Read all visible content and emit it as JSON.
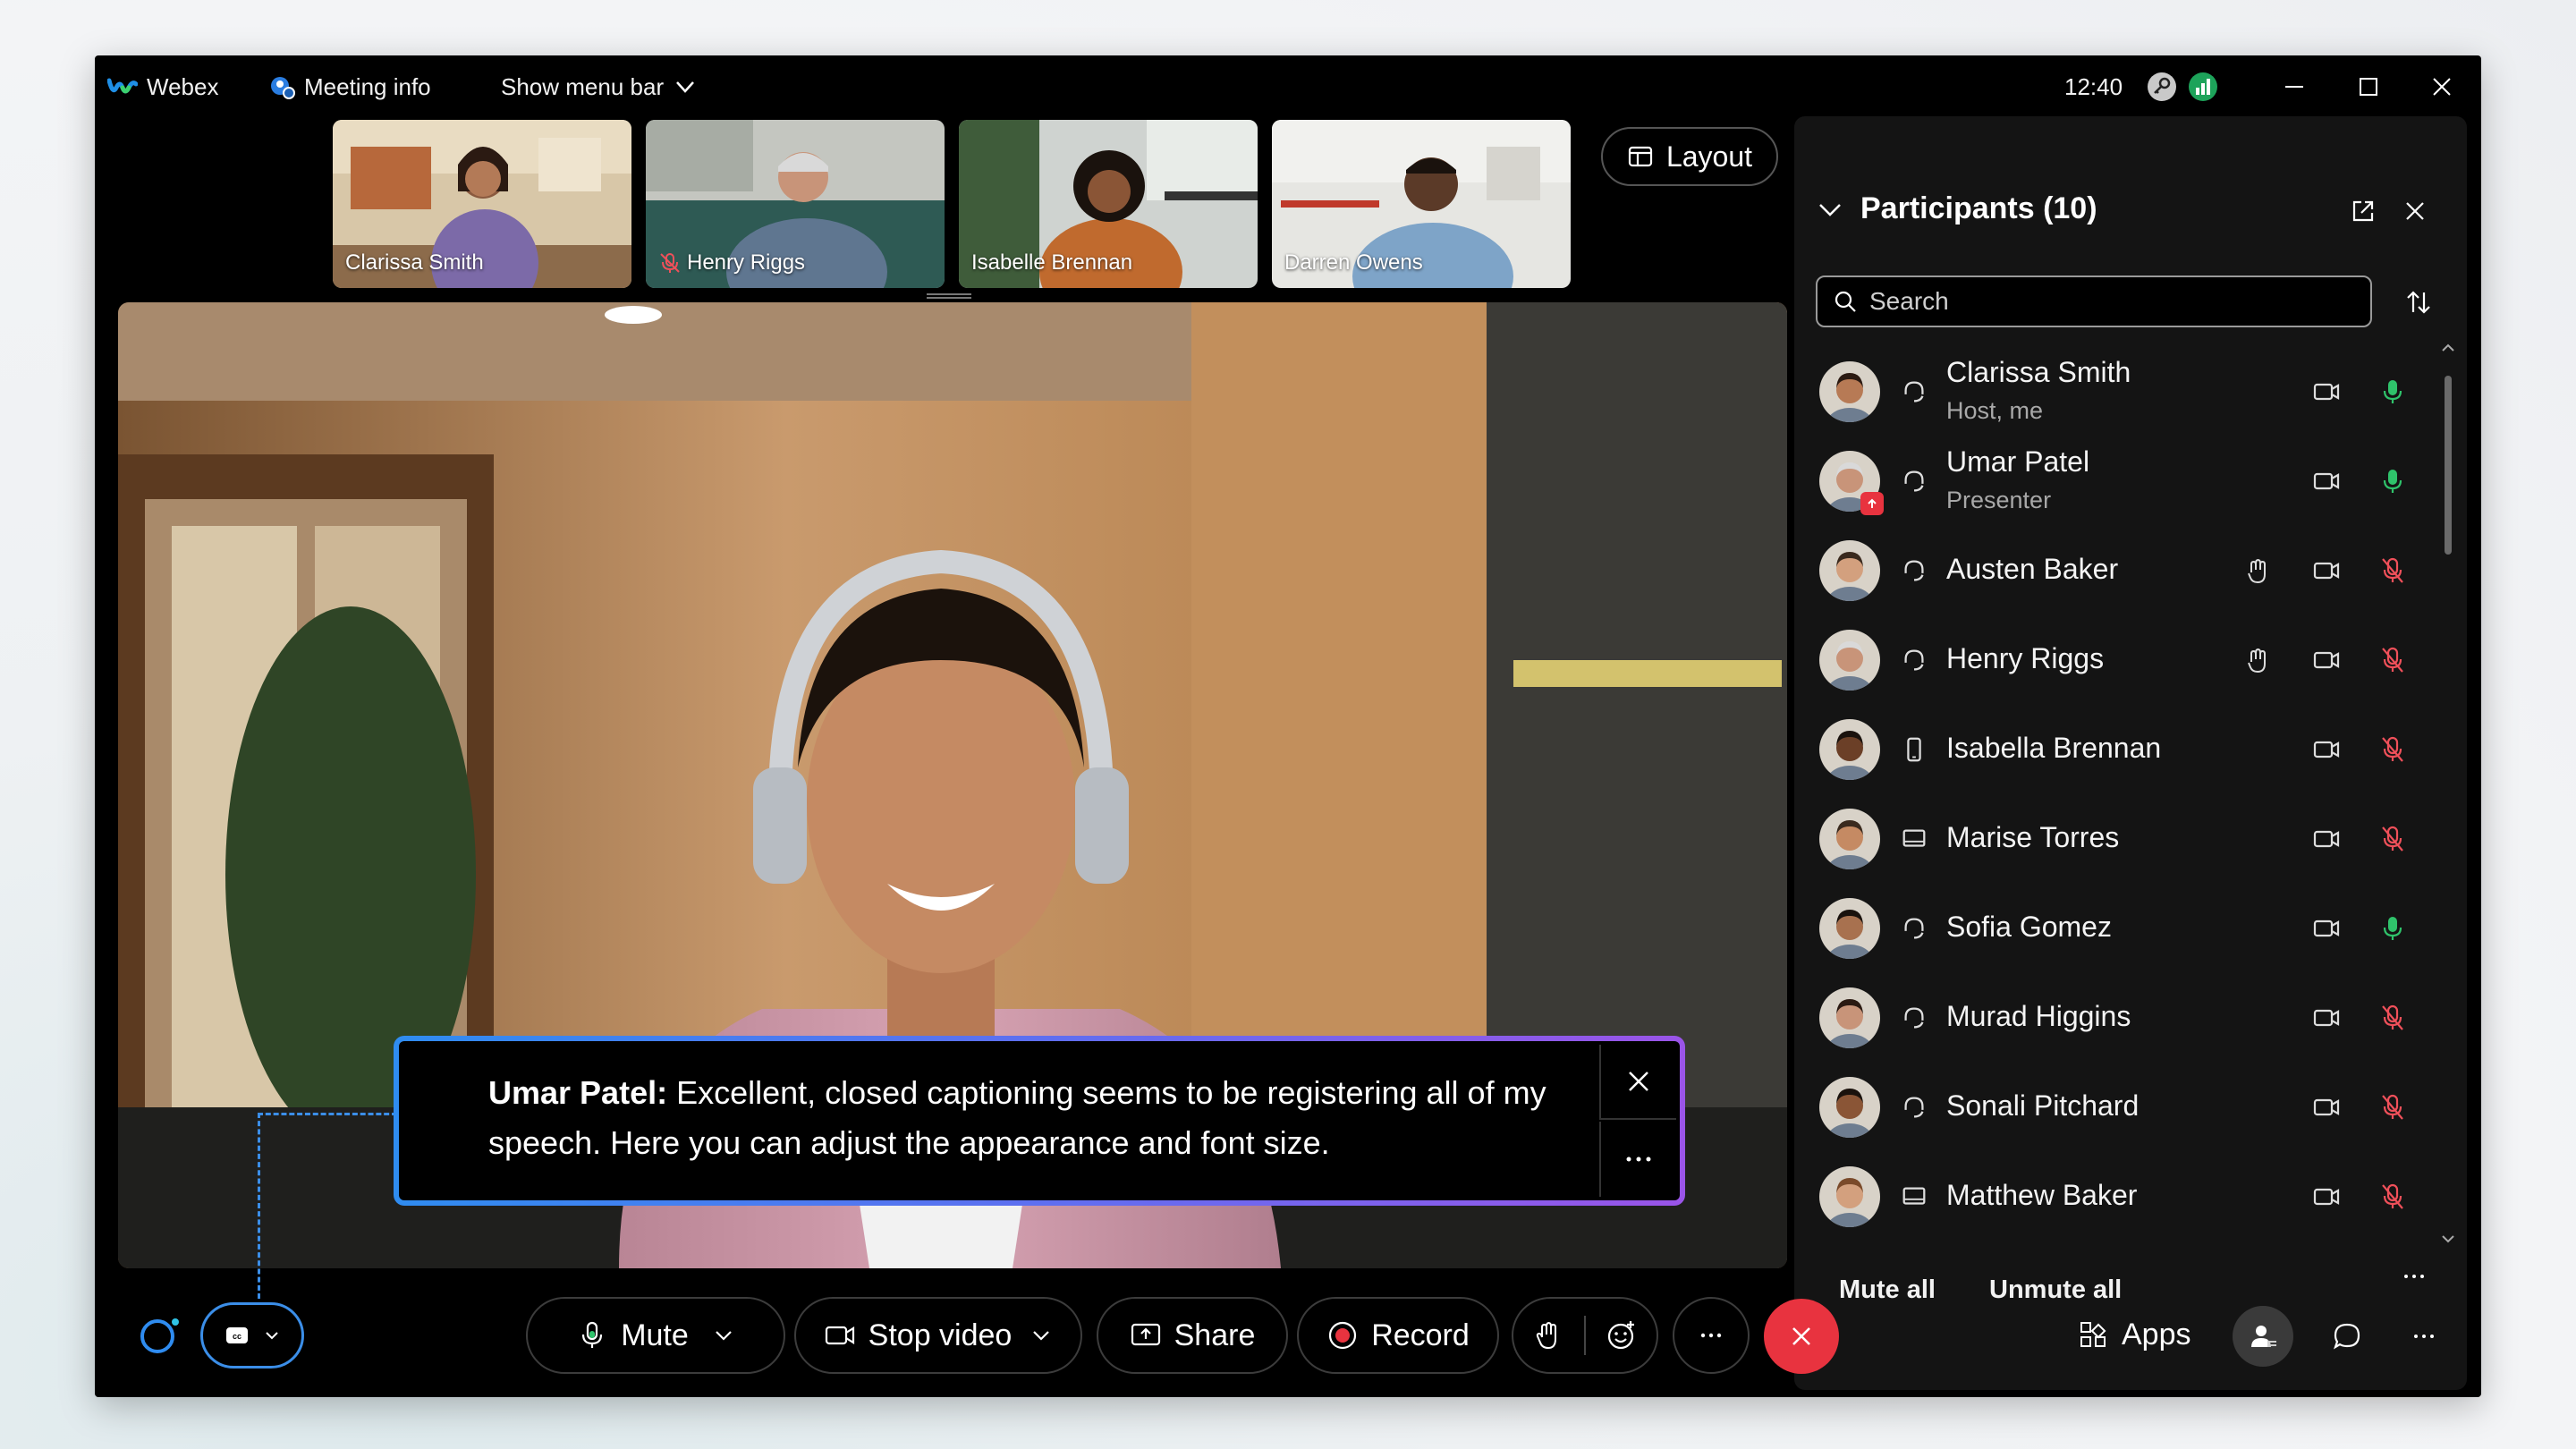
{
  "titlebar": {
    "app_name": "Webex",
    "meeting_info": "Meeting info",
    "show_menu_bar": "Show menu bar",
    "time": "12:40"
  },
  "thumbnails": [
    {
      "name": "Clarissa Smith",
      "muted": false
    },
    {
      "name": "Henry Riggs",
      "muted": true
    },
    {
      "name": "Isabelle Brennan",
      "muted": false
    },
    {
      "name": "Darren Owens",
      "muted": false
    }
  ],
  "layout_label": "Layout",
  "caption": {
    "speaker": "Umar Patel:",
    "text": " Excellent, closed captioning seems to be registering all of my speech. Here you can adjust the appearance and font size."
  },
  "participants": {
    "title": "Participants (10)",
    "search_placeholder": "Search",
    "list": [
      {
        "name": "Clarissa Smith",
        "role": "Host, me",
        "device": "headset-icon",
        "hand": false,
        "mic": "on"
      },
      {
        "name": "Umar Patel",
        "role": "Presenter",
        "device": "headset-icon",
        "hand": false,
        "mic": "on"
      },
      {
        "name": "Austen Baker",
        "role": "",
        "device": "headset-icon",
        "hand": true,
        "mic": "muted"
      },
      {
        "name": "Henry Riggs",
        "role": "",
        "device": "headset-icon",
        "hand": true,
        "mic": "muted"
      },
      {
        "name": "Isabella Brennan",
        "role": "",
        "device": "phone-icon",
        "hand": false,
        "mic": "muted"
      },
      {
        "name": "Marise Torres",
        "role": "",
        "device": "laptop-icon",
        "hand": false,
        "mic": "muted"
      },
      {
        "name": "Sofia Gomez",
        "role": "",
        "device": "headset-icon",
        "hand": false,
        "mic": "on"
      },
      {
        "name": "Murad Higgins",
        "role": "",
        "device": "headset-icon",
        "hand": false,
        "mic": "muted"
      },
      {
        "name": "Sonali Pitchard",
        "role": "",
        "device": "headset-icon",
        "hand": false,
        "mic": "muted"
      },
      {
        "name": "Matthew Baker",
        "role": "",
        "device": "laptop-icon",
        "hand": false,
        "mic": "muted"
      }
    ],
    "mute_all": "Mute all",
    "unmute_all": "Unmute all"
  },
  "controls": {
    "mute": "Mute",
    "stop_video": "Stop video",
    "share": "Share",
    "record": "Record",
    "apps": "Apps"
  },
  "colors": {
    "accent_blue": "#3b8ee8",
    "mic_on_green": "#2fc36b",
    "mic_muted_red": "#f0505a",
    "end_call_red": "#e8333f"
  }
}
